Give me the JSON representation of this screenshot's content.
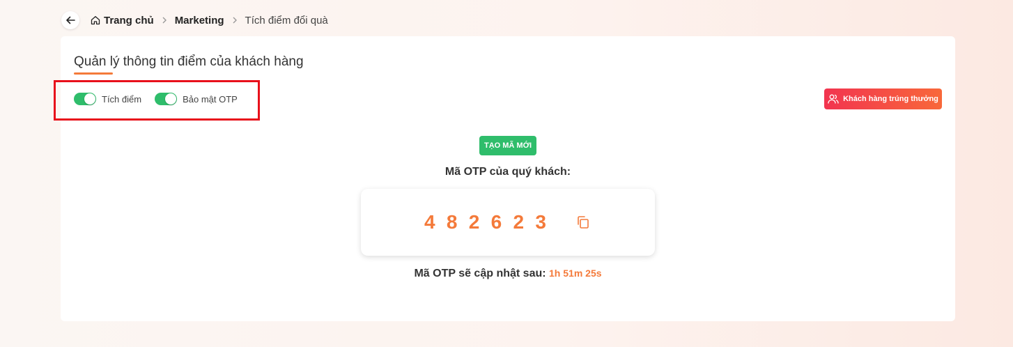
{
  "breadcrumb": {
    "home": "Trang chủ",
    "section": "Marketing",
    "current": "Tích điểm đổi quà"
  },
  "card": {
    "title": "Quản lý thông tin điểm của khách hàng"
  },
  "toggles": [
    {
      "label": "Tích điểm",
      "on": true
    },
    {
      "label": "Bảo mật OTP",
      "on": true
    }
  ],
  "winners_button": {
    "label": "Khách hàng trúng thưởng",
    "icon": "users-icon"
  },
  "new_code_button": {
    "label": "TẠO MÃ MỚI"
  },
  "otp": {
    "label": "Mã OTP của quý khách:",
    "code": "482623",
    "refresh_label": "Mã OTP sẽ cập nhật sau:",
    "refresh_time": "1h 51m 25s"
  },
  "colors": {
    "accent": "#f47a3a",
    "toggle_on": "#2fbd6b",
    "primary_green": "#2fbd6b",
    "danger_gradient_start": "#f2344f",
    "danger_gradient_end": "#f8683a",
    "highlight": "#e8101b"
  }
}
